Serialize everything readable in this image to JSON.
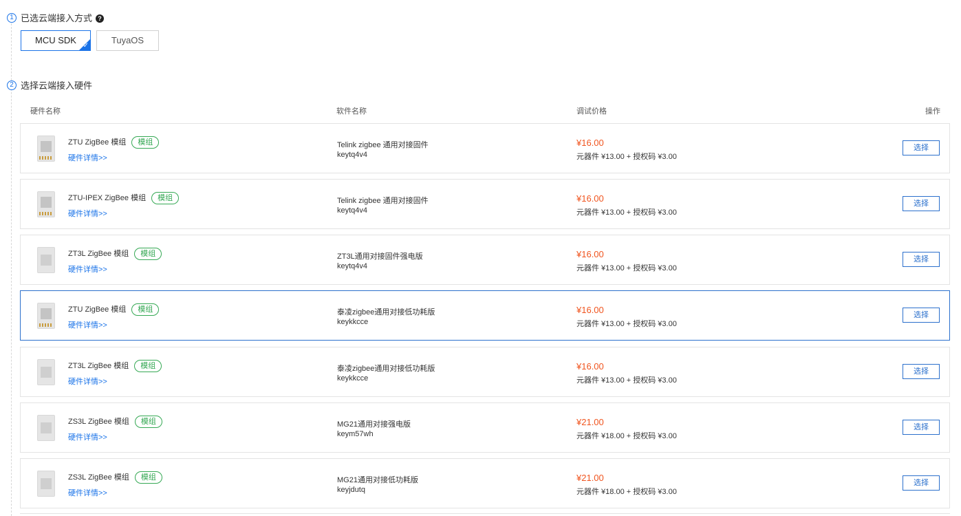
{
  "step1": {
    "number": "1",
    "title": "已选云端接入方式",
    "help_icon": "?"
  },
  "modes": [
    {
      "label": "MCU SDK",
      "selected": true
    },
    {
      "label": "TuyaOS",
      "selected": false
    }
  ],
  "step2": {
    "number": "2",
    "title": "选择云端接入硬件"
  },
  "columns": {
    "hardware": "硬件名称",
    "software": "软件名称",
    "price": "调试价格",
    "action": "操作"
  },
  "rows": [
    {
      "hw": "ZTU ZigBee 模组",
      "tag": "模组",
      "link": "硬件详情>>",
      "sw": "Telink zigbee 通用对接固件",
      "key": "keytq4v4",
      "price": "¥16.00",
      "detail": "元器件 ¥13.00 + 授权码 ¥3.00",
      "btn": "选择"
    },
    {
      "hw": "ZTU-IPEX ZigBee 模组",
      "tag": "模组",
      "link": "硬件详情>>",
      "sw": "Telink zigbee 通用对接固件",
      "key": "keytq4v4",
      "price": "¥16.00",
      "detail": "元器件 ¥13.00 + 授权码 ¥3.00",
      "btn": "选择"
    },
    {
      "hw": "ZT3L ZigBee 模组",
      "tag": "模组",
      "link": "硬件详情>>",
      "sw": "ZT3L通用对接固件强电版",
      "key": "keytq4v4",
      "price": "¥16.00",
      "detail": "元器件 ¥13.00 + 授权码 ¥3.00",
      "btn": "选择"
    },
    {
      "hw": "ZTU ZigBee 模组",
      "tag": "模组",
      "link": "硬件详情>>",
      "sw": "泰凌zigbee通用对接低功耗版",
      "key": "keykkcce",
      "price": "¥16.00",
      "detail": "元器件 ¥13.00 + 授权码 ¥3.00",
      "btn": "选择"
    },
    {
      "hw": "ZT3L ZigBee 模组",
      "tag": "模组",
      "link": "硬件详情>>",
      "sw": "泰凌zigbee通用对接低功耗版",
      "key": "keykkcce",
      "price": "¥16.00",
      "detail": "元器件 ¥13.00 + 授权码 ¥3.00",
      "btn": "选择"
    },
    {
      "hw": "ZS3L ZigBee 模组",
      "tag": "模组",
      "link": "硬件详情>>",
      "sw": "MG21通用对接强电版",
      "key": "keym57wh",
      "price": "¥21.00",
      "detail": "元器件 ¥18.00 + 授权码 ¥3.00",
      "btn": "选择"
    },
    {
      "hw": "ZS3L ZigBee 模组",
      "tag": "模组",
      "link": "硬件详情>>",
      "sw": "MG21通用对接低功耗版",
      "key": "keyjdutq",
      "price": "¥21.00",
      "detail": "元器件 ¥18.00 + 授权码 ¥3.00",
      "btn": "选择"
    }
  ],
  "icons": {
    "check": "checkmark-icon",
    "module": "zigbee-module-image"
  },
  "colors": {
    "accent": "#1a73e8",
    "price": "#f0541e",
    "tag": "#34a853"
  }
}
